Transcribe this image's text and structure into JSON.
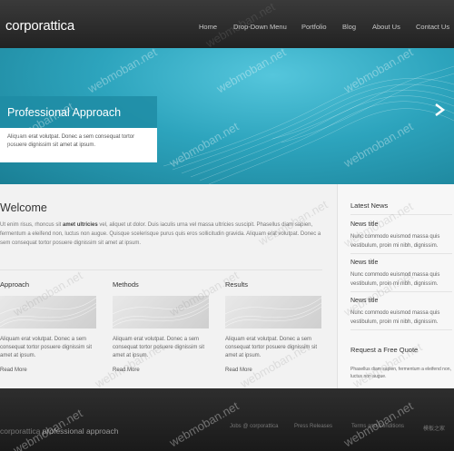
{
  "header": {
    "logo": "corporattica",
    "nav": [
      "Home",
      "Drop-Down Menu",
      "Portfolio",
      "Blog",
      "About Us",
      "Contact Us"
    ]
  },
  "banner": {
    "title": "Professional Approach",
    "text": "Aliquam erat volutpat. Donec a sem consequat tortor posuere dignissim sit amet at ipsum."
  },
  "main": {
    "welcome_title": "Welcome",
    "welcome_text_1": "Ut enim risus, rhoncus sit ",
    "welcome_bold": "amet ultricies",
    "welcome_text_2": " vel, aliquet ut dolor. Duis iaculis urna vel massa ultricies suscipit. Phasellus diam sapien, fermentum a eleifend non, luctus non augue. Quisque scelerisque purus quis eros sollicitudin gravida. Aliquam erat volutpat. Donec a sem consequat tortor posuere dignissim sit amet at ipsum.",
    "columns": [
      {
        "title": "Approach",
        "text": "Aliquam erat volutpat. Donec a sem consequat tortor posuere dignissim sit amet at ipsum.",
        "link": "Read More"
      },
      {
        "title": "Methods",
        "text": "Aliquam erat volutpat. Donec a sem consequat tortor posuere dignissim sit amet at ipsum.",
        "link": "Read More"
      },
      {
        "title": "Results",
        "text": "Aliquam erat volutpat. Donec a sem consequat tortor posuere dignissim sit amet at ipsum.",
        "link": "Read More"
      }
    ]
  },
  "sidebar": {
    "latest_news": "Latest News",
    "news": [
      {
        "title": "News title",
        "text": "Nunc commodo euismod massa quis vestibulum, proin mi nibh, dignissim."
      },
      {
        "title": "News title",
        "text": "Nunc commodo euismod massa quis vestibulum, proin mi nibh, dignissim."
      },
      {
        "title": "News title",
        "text": "Nunc commodo euismod massa quis vestibulum, proin mi nibh, dignissim."
      }
    ],
    "quote_title": "Request a Free Quote",
    "quote_text": "Phasellus diam sapien, fermentum a eleifend non, luctus non augue."
  },
  "footer": {
    "brand": "corporattica",
    "tagline": "professional approach",
    "links": [
      "Jobs @ corporattica",
      "Press Releases",
      "Terms and Conditions",
      "模板之家"
    ]
  },
  "watermark": "webmoban.net",
  "colors": {
    "accent": "#2da4bd",
    "header": "#2a2a2a"
  }
}
